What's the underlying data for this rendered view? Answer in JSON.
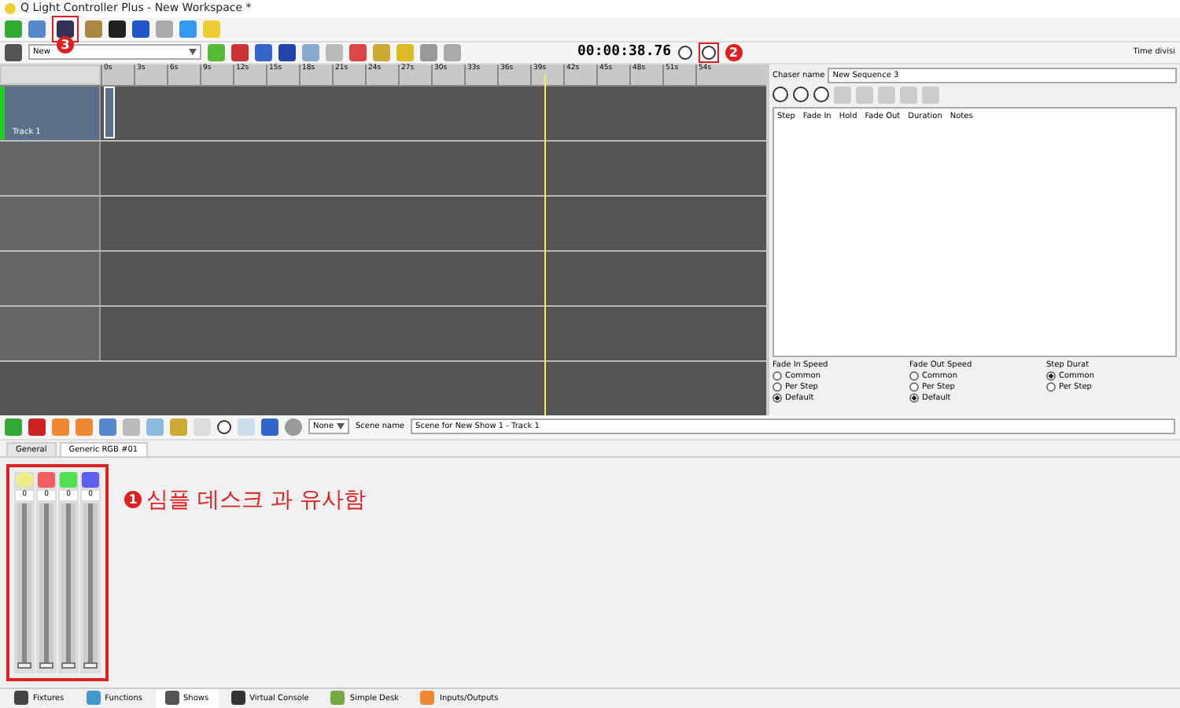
{
  "window": {
    "title": "Q Light Controller Plus - New Workspace *"
  },
  "show_toolbar": {
    "show": "New",
    "time": "00:00:38.76",
    "time_division": "Time divisi"
  },
  "annotations": {
    "save_marker": "3",
    "play_marker": "2",
    "desk_marker": "1",
    "desk_note": "심플 데스크 과 유사함"
  },
  "timeline": {
    "ticks": [
      "0s",
      "3s",
      "6s",
      "9s",
      "12s",
      "15s",
      "18s",
      "21s",
      "24s",
      "27s",
      "30s",
      "33s",
      "36s",
      "39s",
      "42s",
      "45s",
      "48s",
      "51s",
      "54s"
    ],
    "tracks": [
      {
        "name": "Track 1",
        "selected": true
      },
      {
        "selected": false
      },
      {
        "selected": false
      },
      {
        "selected": false
      },
      {
        "selected": false
      }
    ]
  },
  "chaser": {
    "name_label": "Chaser name",
    "name": "New Sequence 3",
    "columns": [
      "Step",
      "Fade In",
      "Hold",
      "Fade Out",
      "Duration",
      "Notes"
    ],
    "groups": [
      {
        "title": "Fade In Speed",
        "options": [
          {
            "label": "Common",
            "selected": false
          },
          {
            "label": "Per Step",
            "selected": false
          },
          {
            "label": "Default",
            "selected": true
          }
        ]
      },
      {
        "title": "Fade Out Speed",
        "options": [
          {
            "label": "Common",
            "selected": false
          },
          {
            "label": "Per Step",
            "selected": false
          },
          {
            "label": "Default",
            "selected": true
          }
        ]
      },
      {
        "title": "Step Durat",
        "options": [
          {
            "label": "Common",
            "selected": true
          },
          {
            "label": "Per Step",
            "selected": false
          }
        ]
      }
    ]
  },
  "scene": {
    "mode": "None",
    "name_label": "Scene name",
    "name": "Scene for New Show 1 - Track 1",
    "tabs": [
      {
        "label": "General",
        "selected": false
      },
      {
        "label": "Generic RGB #01",
        "selected": true
      }
    ],
    "channels": [
      {
        "kind": "intensity",
        "value": "0",
        "level": 0
      },
      {
        "kind": "color",
        "color": "#f06060",
        "value": "0",
        "level": 0
      },
      {
        "kind": "color",
        "color": "#50e050",
        "value": "0",
        "level": 0
      },
      {
        "kind": "color",
        "color": "#6060f0",
        "value": "0",
        "level": 0
      }
    ]
  },
  "bottom_tabs": [
    {
      "label": "Fixtures",
      "selected": false
    },
    {
      "label": "Functions",
      "selected": false
    },
    {
      "label": "Shows",
      "selected": true
    },
    {
      "label": "Virtual Console",
      "selected": false
    },
    {
      "label": "Simple Desk",
      "selected": false
    },
    {
      "label": "Inputs/Outputs",
      "selected": false
    }
  ]
}
